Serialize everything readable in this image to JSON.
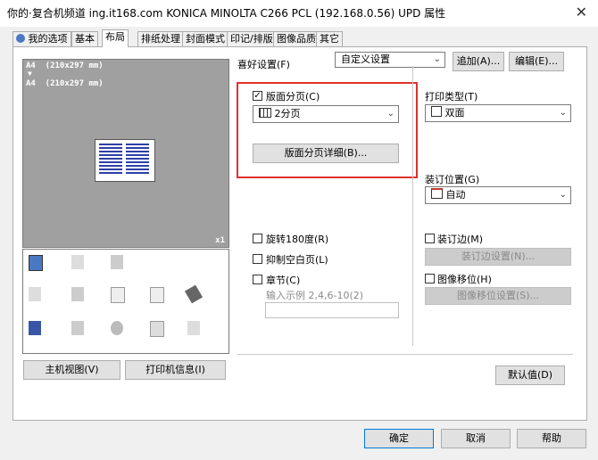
{
  "window": {
    "title": "你的·复合机频道 ing.it168.com KONICA MINOLTA C266 PCL (192.168.0.56) UPD 属性",
    "close_glyph": "✕"
  },
  "tabs": [
    {
      "label": "我的选项",
      "icon": "user-icon"
    },
    {
      "label": "基本"
    },
    {
      "label": "布局",
      "active": true
    },
    {
      "label": "排纸处理"
    },
    {
      "label": "封面模式"
    },
    {
      "label": "印记/排版"
    },
    {
      "label": "图像品质"
    },
    {
      "label": "其它"
    }
  ],
  "preview": {
    "paper_line1": "A4  (210x297 mm)",
    "arrow": "▼",
    "paper_line2": "A4  (210x297 mm)",
    "copies": "x1"
  },
  "left_buttons": {
    "host_view": "主机视图(V)",
    "printer_info": "打印机信息(I)"
  },
  "favorites": {
    "label": "喜好设置(F)",
    "value": "自定义设置",
    "add": "追加(A)...",
    "edit": "编辑(E)..."
  },
  "combination": {
    "checkbox_label": "版面分页(C)",
    "checked": true,
    "value": "2分页",
    "detail_button": "版面分页详细(B)..."
  },
  "rotate": {
    "label": "旋转180度(R)",
    "checked": false
  },
  "skip_blank": {
    "label": "抑制空白页(L)",
    "checked": false
  },
  "chapter": {
    "label": "章节(C)",
    "checked": false,
    "hint": "输入示例 2,4,6-10(2)",
    "value": ""
  },
  "print_type": {
    "label": "打印类型(T)",
    "value": "双面"
  },
  "binding_position": {
    "label": "装订位置(G)",
    "value": "自动"
  },
  "binding_margin": {
    "label": "装订边(M)",
    "checked": false,
    "button": "装订边设置(N)..."
  },
  "image_shift": {
    "label": "图像移位(H)",
    "checked": false,
    "button": "图像移位设置(S)..."
  },
  "default_button": "默认值(D)",
  "footer": {
    "ok": "确定",
    "cancel": "取消",
    "help": "帮助"
  },
  "colors": {
    "highlight_box": "#e0312c",
    "accent": "#0078d7"
  }
}
